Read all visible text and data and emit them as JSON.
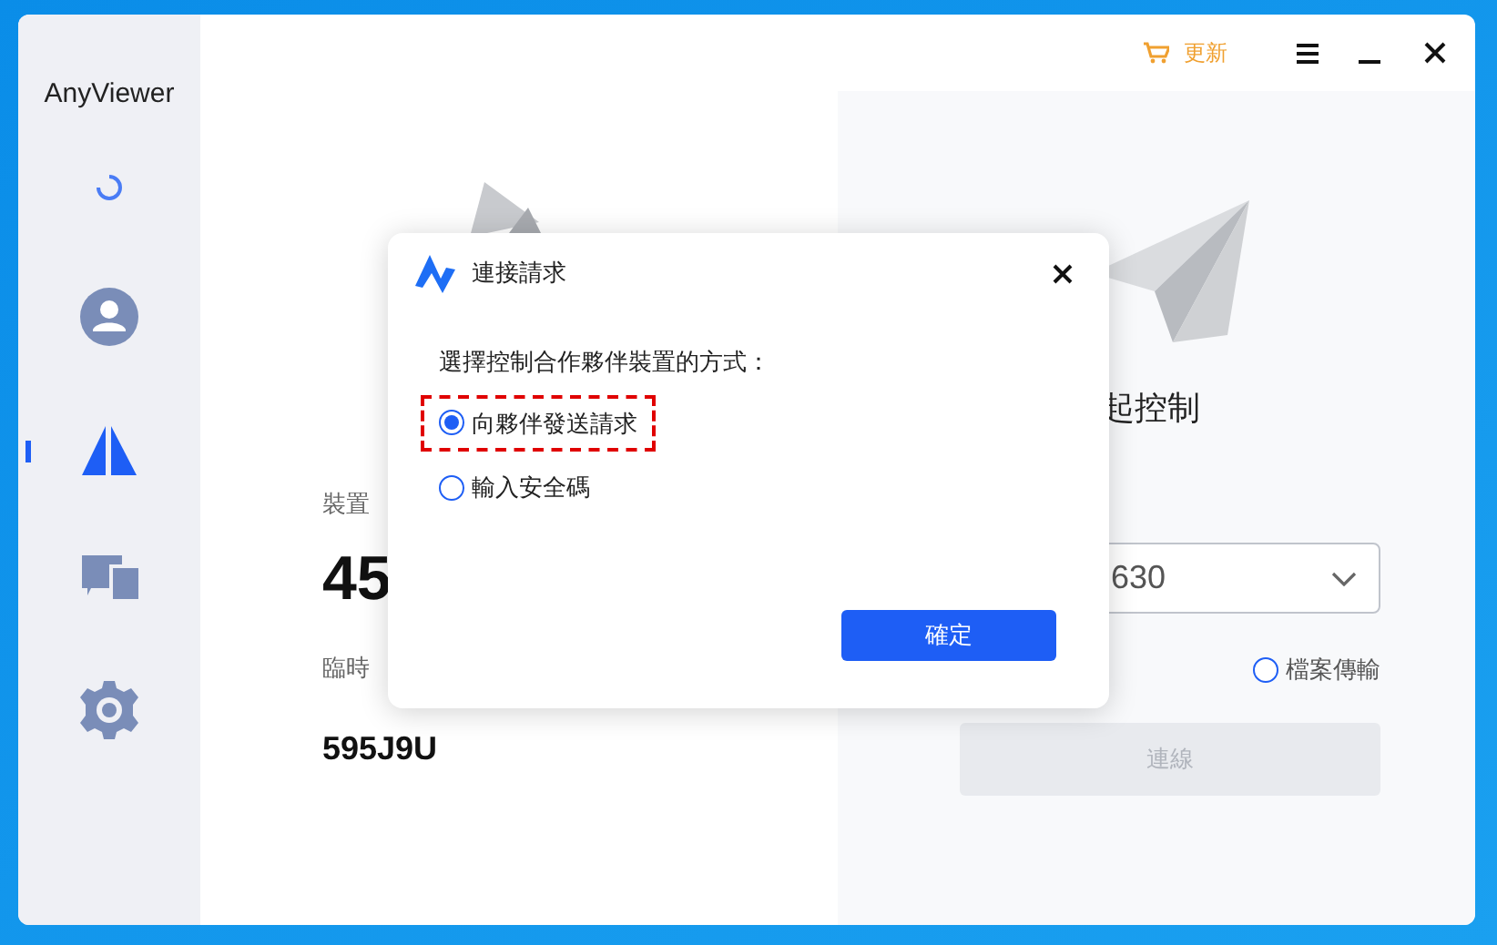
{
  "window": {
    "title": "AnyViewer"
  },
  "toolbar": {
    "update": "更新"
  },
  "sidebar": {
    "items": [
      {
        "kind": "account",
        "selected": false
      },
      {
        "kind": "control",
        "selected": true
      },
      {
        "kind": "devices",
        "selected": false
      },
      {
        "kind": "settings",
        "selected": false
      }
    ]
  },
  "left": {
    "device_id_label": "裝置",
    "device_id": "45",
    "temp_code_label": "臨時",
    "temp_code": "595J9U"
  },
  "right": {
    "title": "起控制",
    "partner_field": {
      "value": "630"
    },
    "file_transfer": {
      "label": "檔案傳輸",
      "selected": false
    },
    "connect_button": {
      "label": "連線",
      "disabled": true
    }
  },
  "dialog": {
    "title": "連接請求",
    "prompt": "選擇控制合作夥伴裝置的方式：",
    "options": [
      {
        "label": "向夥伴發送請求",
        "selected": true,
        "highlighted": true
      },
      {
        "label": "輸入安全碼",
        "selected": false,
        "highlighted": false
      }
    ],
    "ok_button": "確定"
  }
}
